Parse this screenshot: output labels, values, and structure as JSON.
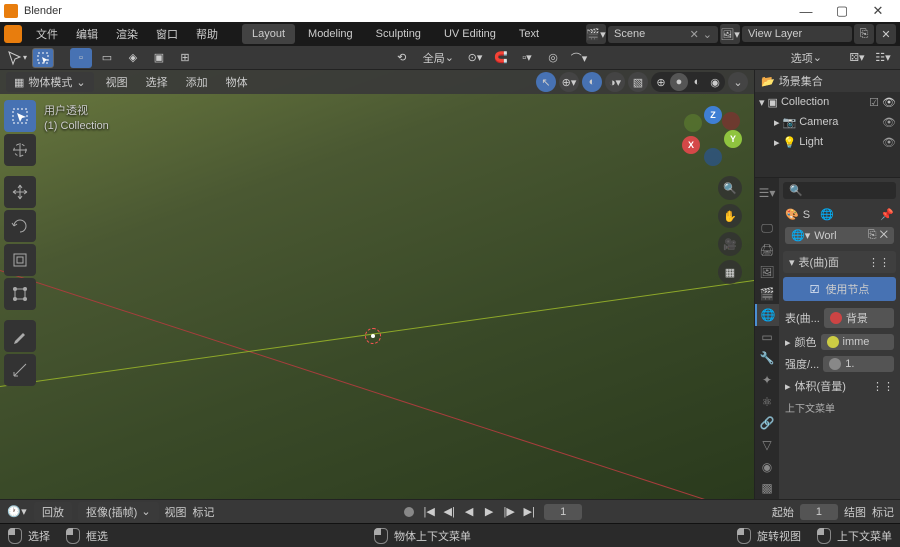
{
  "app": {
    "title": "Blender"
  },
  "menus": {
    "file": "文件",
    "edit": "编辑",
    "render": "渲染",
    "window": "窗口",
    "help": "帮助"
  },
  "tabs": {
    "layout": "Layout",
    "modeling": "Modeling",
    "sculpting": "Sculpting",
    "uv": "UV Editing",
    "text": "Text"
  },
  "scene": {
    "label": "Scene",
    "layer": "View Layer"
  },
  "toolbar": {
    "pivot": "全局",
    "options": "选项"
  },
  "vp": {
    "mode": "物体模式",
    "view": "视图",
    "select": "选择",
    "add": "添加",
    "object": "物体",
    "info1": "用户透视",
    "info2": "(1) Collection",
    "gizmo": {
      "x": "X",
      "y": "Y",
      "z": "Z"
    }
  },
  "outliner": {
    "header": "场景集合",
    "collection": "Collection",
    "camera": "Camera",
    "light": "Light"
  },
  "props": {
    "s": "S",
    "world": "Worl",
    "surface_hdr": "表(曲)面",
    "use_nodes": "使用节点",
    "surface_lbl": "表(曲...",
    "background": "背景",
    "color_lbl": "颜色",
    "color_val": "imme",
    "strength_lbl": "强度/...",
    "strength_val": "1.",
    "volume": "体积(音量)",
    "context": "上下文菜单"
  },
  "timeline": {
    "playback": "回放",
    "keying": "抠像(插帧)",
    "view": "视图",
    "marker": "标记",
    "frame": "1",
    "start_lbl": "起始",
    "start": "1",
    "end_lbl": "结图",
    "marker2": "标记"
  },
  "status": {
    "select": "选择",
    "box": "框选",
    "ctx": "物体上下文菜单",
    "rotate": "旋转视图",
    "ctx2": "上下文菜单"
  }
}
